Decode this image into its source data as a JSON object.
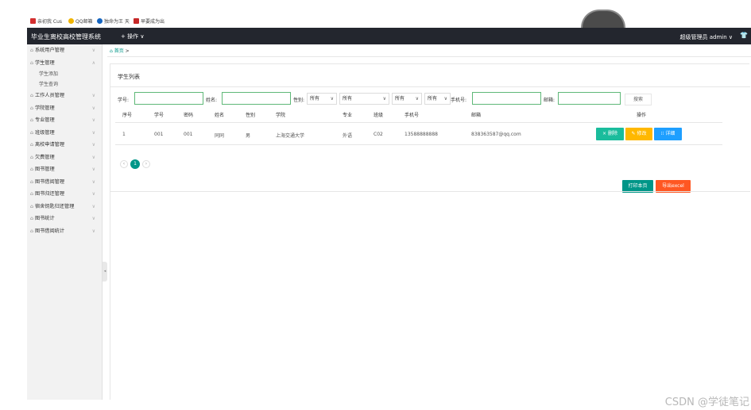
{
  "bookmarks": [
    {
      "label": "亲初我 Cus",
      "icon": "c-logo-icon",
      "color": "#d32f2f"
    },
    {
      "label": "QQ邮箱",
      "icon": "qq-mail-icon",
      "color": "#f0b400"
    },
    {
      "label": "独命为王 天",
      "icon": "bookmark-icon",
      "color": "#1565c0"
    },
    {
      "label": "早要成为出",
      "icon": "m-logo-icon",
      "color": "#c62828"
    }
  ],
  "header": {
    "title": "毕业生离校高校管理系统",
    "ops_label": "+ 操作 ∨",
    "user_label": "超级管理员  admin ∨"
  },
  "sidebar": {
    "items": [
      {
        "label": "系统用户管理"
      },
      {
        "label": "学生管理",
        "expanded": true,
        "children": [
          {
            "label": "学生添加"
          },
          {
            "label": "学生查询"
          }
        ]
      },
      {
        "label": "工作人员管理"
      },
      {
        "label": "学院管理"
      },
      {
        "label": "专业管理"
      },
      {
        "label": "班级管理"
      },
      {
        "label": "离校申请管理"
      },
      {
        "label": "欠费管理"
      },
      {
        "label": "图书管理"
      },
      {
        "label": "图书借阅管理"
      },
      {
        "label": "图书归还管理"
      },
      {
        "label": "宿舍钥匙归还管理"
      },
      {
        "label": "图书统计"
      },
      {
        "label": "图书借阅统计"
      }
    ]
  },
  "breadcrumb": {
    "home": "首页",
    "sep": ">"
  },
  "panel": {
    "title": "学生列表"
  },
  "filters": {
    "student_no_label": "学号:",
    "name_label": "姓名:",
    "gender_label": "性别:",
    "gender_value": "所有",
    "major_value": "所有",
    "class_value": "所有",
    "college_value": "所有",
    "phone_label": "手机号:",
    "email_label": "邮箱:",
    "search_label": "搜索"
  },
  "table": {
    "headers": [
      "序号",
      "学号",
      "密码",
      "姓名",
      "性别",
      "学院",
      "专业",
      "班级",
      "手机号",
      "邮箱",
      "操作"
    ],
    "rows": [
      [
        "1",
        "001",
        "001",
        "同同",
        "男",
        "上海交通大学",
        "外语",
        "C02",
        "13588888888",
        "838363587@qq.com"
      ]
    ],
    "actions": {
      "delete": "× 删除",
      "edit": "✎ 修改",
      "detail": "⁝⁝ 详细"
    }
  },
  "pagination": {
    "current": "1",
    "prev": "‹",
    "next": "›"
  },
  "buttons": {
    "print": "打印本页",
    "export": "导出excel"
  },
  "watermark": "CSDN @学徒笔记",
  "colors": {
    "topbar": "#23262e",
    "primary": "#009688",
    "delete": "#1abc9c",
    "edit": "#ffb800",
    "detail": "#1e9fff",
    "export": "#ff5722"
  }
}
